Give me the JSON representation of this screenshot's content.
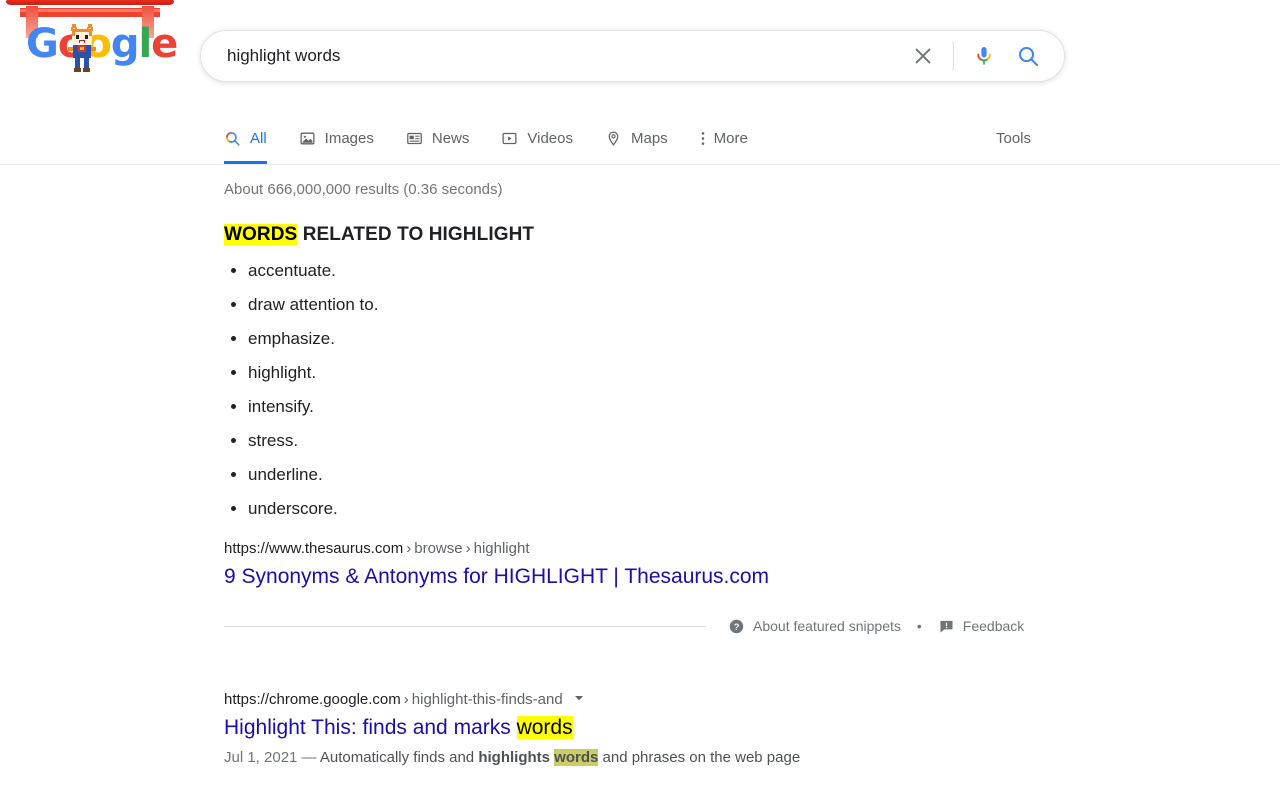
{
  "doodle": {
    "name": "google-doodle-torii-cat",
    "logo_letters": [
      "G",
      "o",
      "o",
      "g",
      "l",
      "e"
    ],
    "colors": {
      "blue": "#4285f4",
      "red": "#ea4335",
      "yellow": "#fbbc05",
      "green": "#34a853",
      "torii_red": "#e8291c"
    }
  },
  "search": {
    "value": "highlight words",
    "placeholder": "Search",
    "clear_icon": "close-icon",
    "mic_icon": "microphone-icon",
    "search_icon": "search-icon"
  },
  "nav": {
    "tabs": [
      {
        "label": "All",
        "icon": "search-icon",
        "active": true
      },
      {
        "label": "Images",
        "icon": "image-icon",
        "active": false
      },
      {
        "label": "News",
        "icon": "news-icon",
        "active": false
      },
      {
        "label": "Videos",
        "icon": "video-icon",
        "active": false
      },
      {
        "label": "Maps",
        "icon": "map-pin-icon",
        "active": false
      },
      {
        "label": "More",
        "icon": "kebab-menu-icon",
        "active": false
      }
    ],
    "tools_label": "Tools"
  },
  "results_stats": "About 666,000,000 results (0.36 seconds)",
  "featured_snippet": {
    "heading_highlight": "WORDS",
    "heading_rest": " RELATED TO HIGHLIGHT",
    "items": [
      "accentuate.",
      "draw attention to.",
      "emphasize.",
      "highlight.",
      "intensify.",
      "stress.",
      "underline.",
      "underscore."
    ],
    "source": {
      "url_domain": "https://www.thesaurus.com",
      "crumb1": "browse",
      "crumb2": "highlight",
      "title": "9 Synonyms & Antonyms for HIGHLIGHT | Thesaurus.com"
    },
    "footer": {
      "about_label": "About featured snippets",
      "separator": "•",
      "feedback_label": "Feedback",
      "help_icon": "question-circle-icon",
      "feedback_icon": "flag-comment-icon"
    }
  },
  "result_two": {
    "url_domain": "https://chrome.google.com",
    "crumb1": "highlight-this-finds-and",
    "title_prefix": "Highlight This: finds and marks ",
    "title_highlight": "words",
    "snippet_date": "Jul 1, 2021",
    "snippet_dash": " — ",
    "snippet_part1": "Automatically finds and ",
    "snippet_bold": "highlights",
    "snippet_space": " ",
    "snippet_highlight": "words",
    "snippet_part2": " and phrases on the web page",
    "dropdown_icon": "chevron-down-icon"
  },
  "colors": {
    "highlight_yellow": "#ffff00",
    "highlight_olive": "#cccc66",
    "link_blue": "#1a0dab",
    "accent_blue": "#1a73e8",
    "text_gray": "#70757a"
  }
}
